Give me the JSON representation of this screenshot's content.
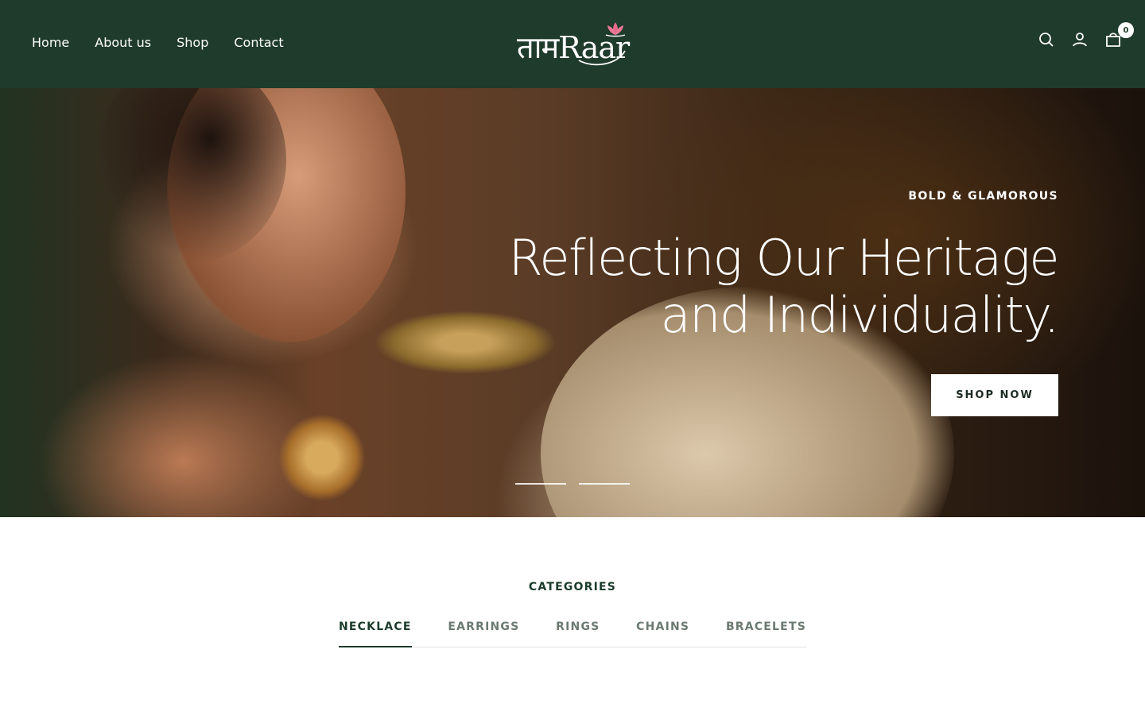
{
  "header": {
    "nav": [
      {
        "label": "Home"
      },
      {
        "label": "About us"
      },
      {
        "label": "Shop"
      },
      {
        "label": "Contact"
      }
    ],
    "logo_text": "तामRaar",
    "icons": [
      "search-icon",
      "account-icon",
      "cart-icon"
    ],
    "cart_count": "0"
  },
  "hero": {
    "eyebrow": "BOLD & GLAMOROUS",
    "headline": "Reflecting Our Heritage and Individuality.",
    "button_label": "SHOP NOW",
    "slide_count": 2
  },
  "categories": {
    "title": "CATEGORIES",
    "tabs": [
      "NECKLACE",
      "EARRINGS",
      "RINGS",
      "CHAINS",
      "BRACELETS"
    ],
    "active_tab": "NECKLACE"
  },
  "colors": {
    "header_bg": "#1f3b2b",
    "accent": "#1c3b2b"
  }
}
